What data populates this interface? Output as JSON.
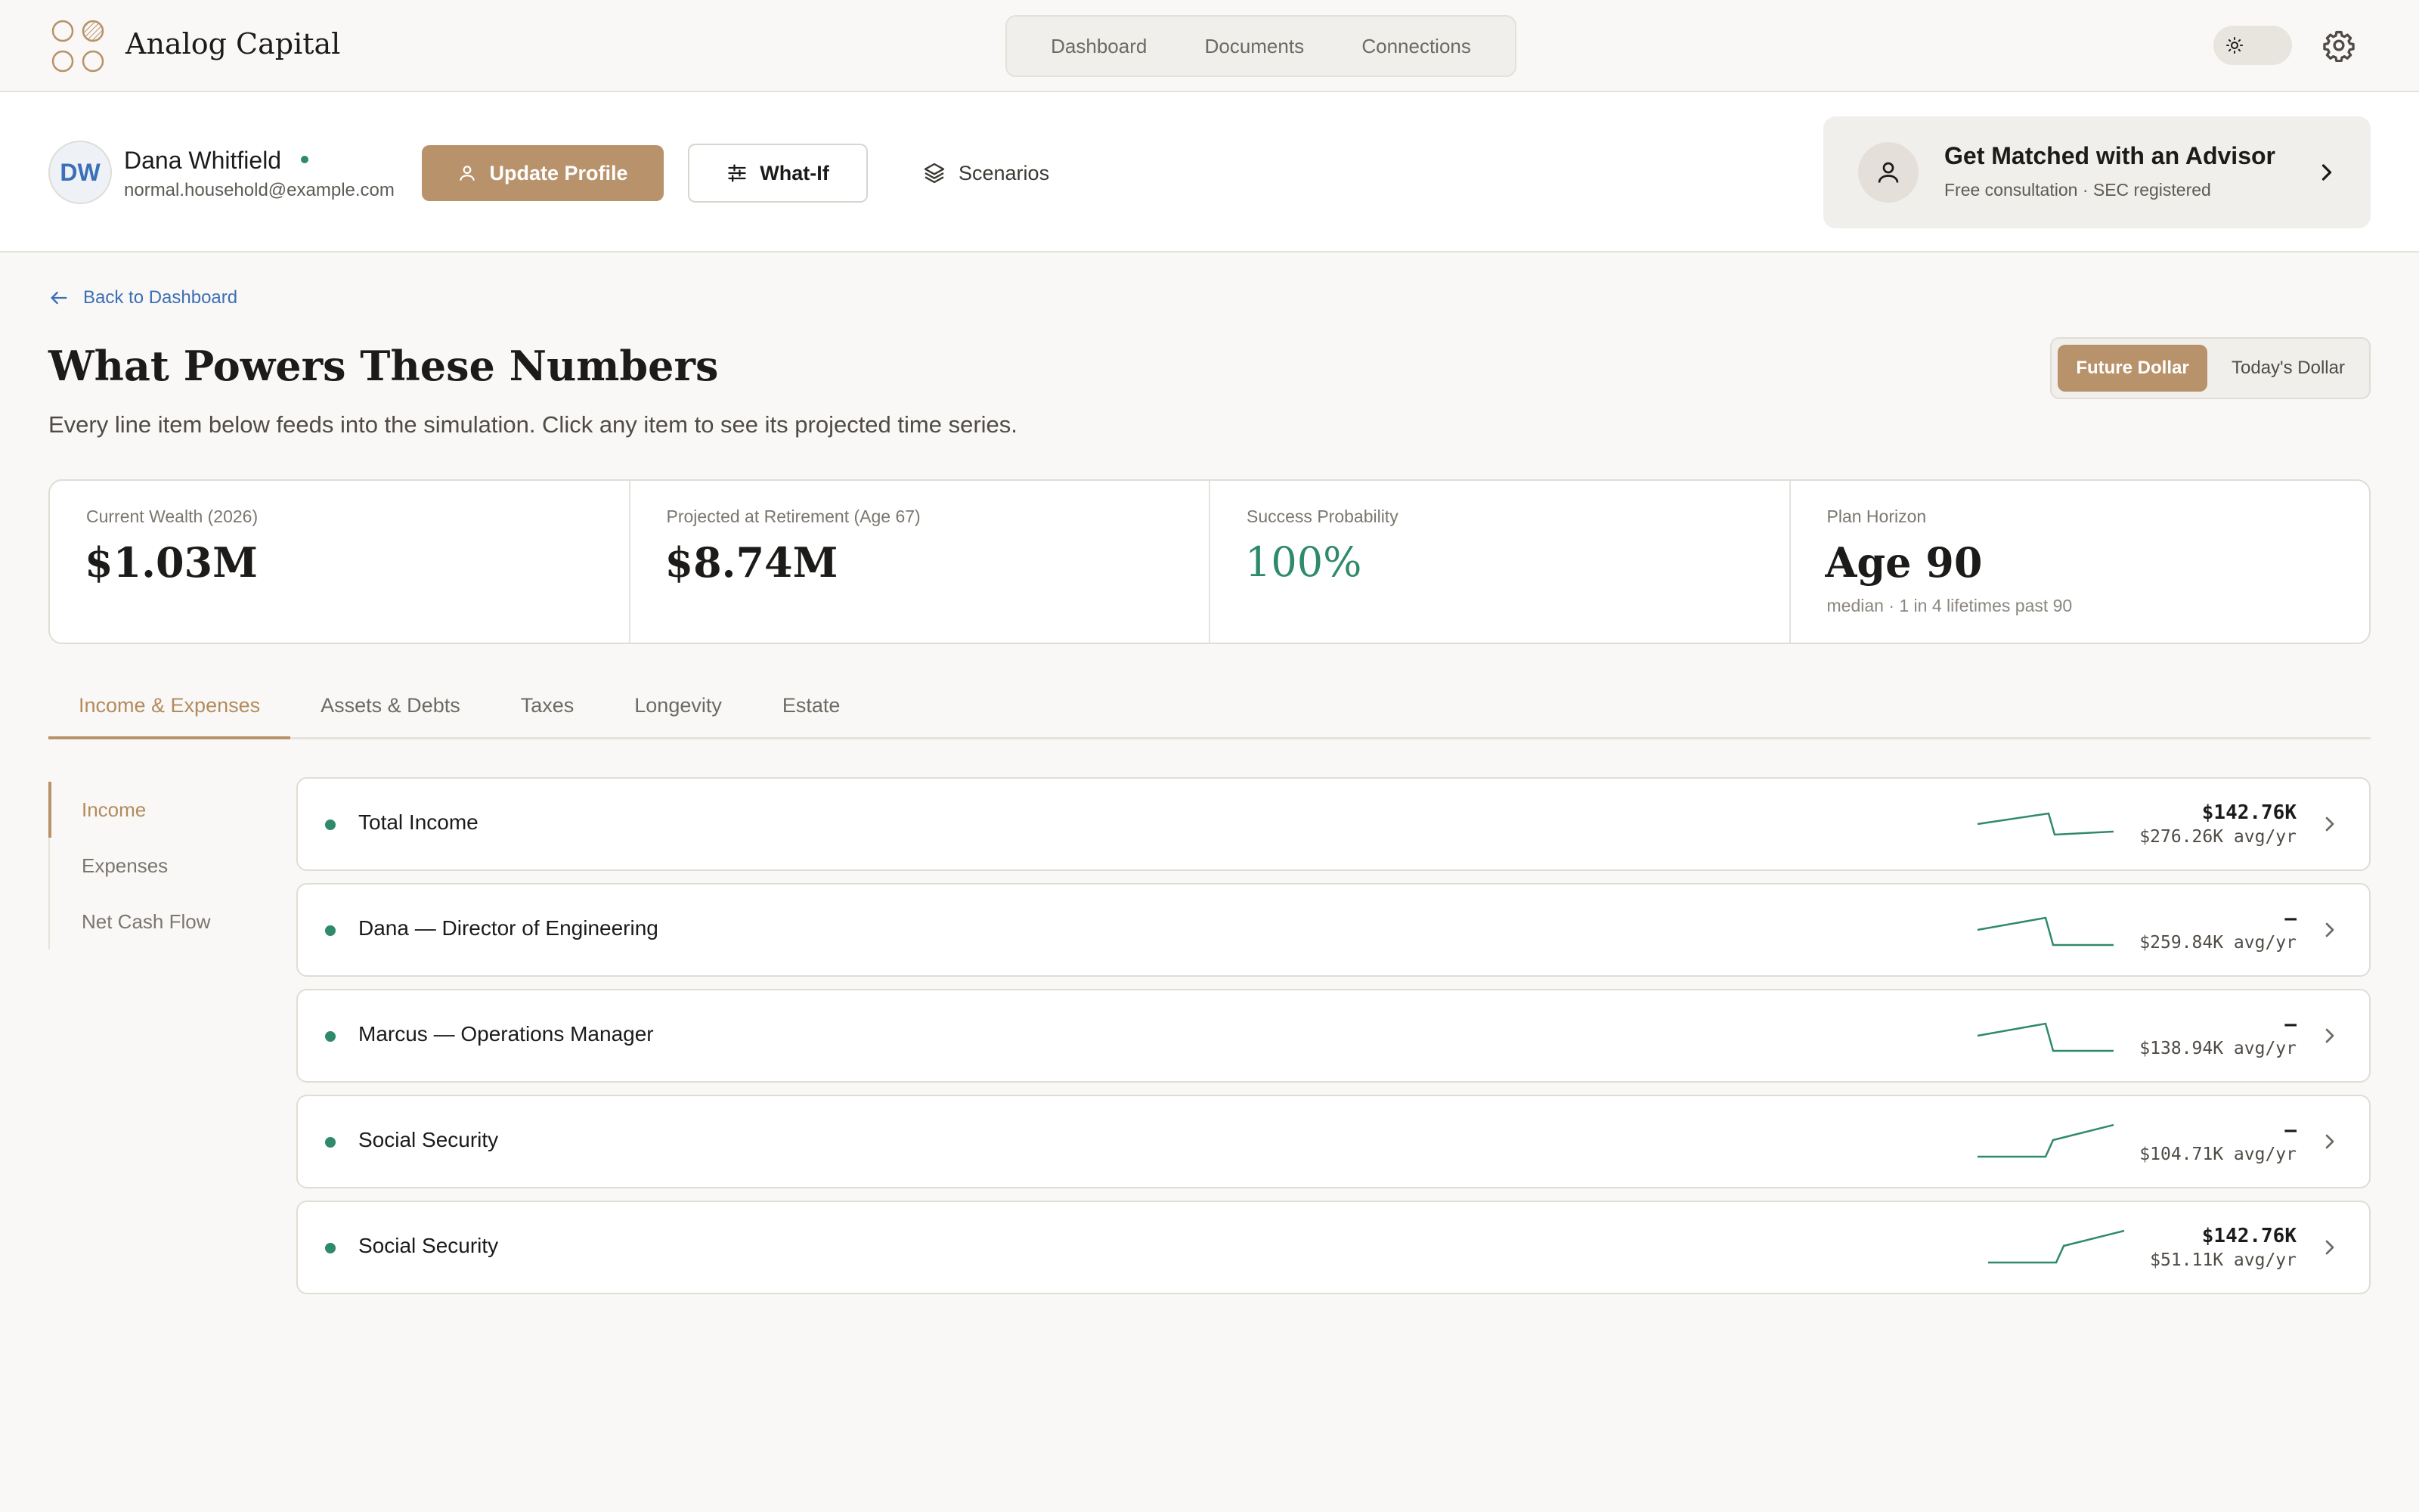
{
  "app": {
    "brand": "Analog Capital"
  },
  "nav": {
    "items": [
      "Dashboard",
      "Documents",
      "Connections"
    ]
  },
  "user": {
    "initials": "DW",
    "name": "Dana Whitfield",
    "email": "normal.household@example.com"
  },
  "actions": {
    "update_profile": "Update Profile",
    "what_if": "What-If",
    "scenarios": "Scenarios"
  },
  "advisor": {
    "title": "Get Matched with an Advisor",
    "subtitle": "Free consultation · SEC registered"
  },
  "page": {
    "back": "Back to Dashboard",
    "title": "What Powers These Numbers",
    "subtitle": "Every line item below feeds into the simulation. Click any item to see its projected time series."
  },
  "dollar_toggle": {
    "active": "Future Dollar",
    "inactive": "Today's Dollar"
  },
  "stats": [
    {
      "label": "Current Wealth (2026)",
      "value": "$1.03M",
      "note": ""
    },
    {
      "label": "Projected at Retirement (Age 67)",
      "value": "$8.74M",
      "note": ""
    },
    {
      "label": "Success Probability",
      "value": "100%",
      "note": ""
    },
    {
      "label": "Plan Horizon",
      "value": "Age 90",
      "note": "median · 1 in 4 lifetimes past 90"
    }
  ],
  "tabs": [
    "Income & Expenses",
    "Assets & Debts",
    "Taxes",
    "Longevity",
    "Estate"
  ],
  "sidenav": [
    "Income",
    "Expenses",
    "Net Cash Flow"
  ],
  "rows": [
    {
      "label": "Total Income",
      "value": "$142.76K",
      "avg": "$276.26K avg/yr"
    },
    {
      "label": "Dana — Director of Engineering",
      "value": "–",
      "avg": "$259.84K avg/yr"
    },
    {
      "label": "Marcus — Operations Manager",
      "value": "–",
      "avg": "$138.94K avg/yr"
    },
    {
      "label": "Social Security",
      "value": "–",
      "avg": "$104.71K avg/yr"
    },
    {
      "label": "Social Security",
      "value": "$142.76K",
      "avg": "$51.11K avg/yr"
    }
  ],
  "colors": {
    "accent": "#b8926a",
    "positive": "#2f8a69",
    "link": "#3b6fb6"
  }
}
